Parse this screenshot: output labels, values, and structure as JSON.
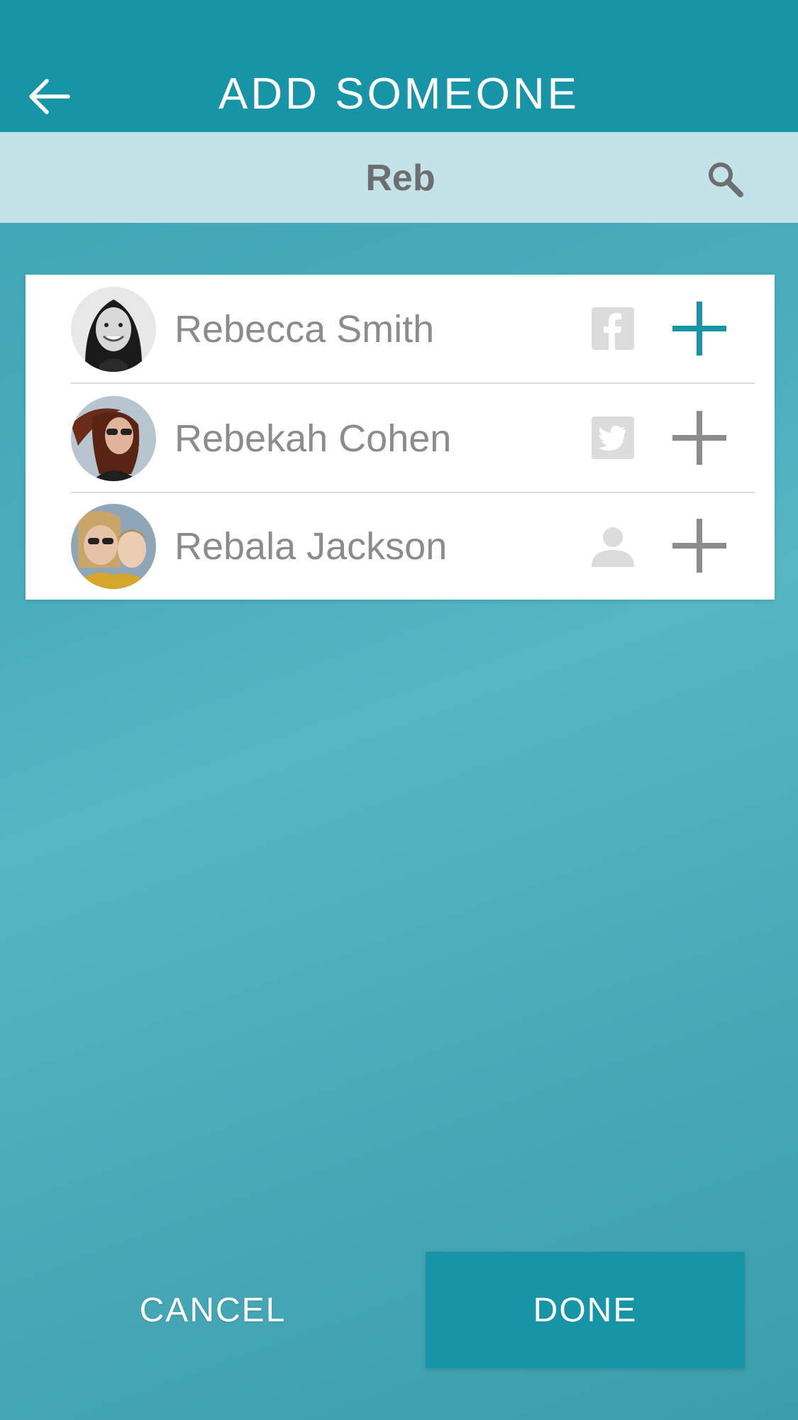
{
  "header": {
    "title": "ADD SOMEONE",
    "back_icon": "arrow-left-icon"
  },
  "search": {
    "value": "Reb",
    "icon": "search-icon"
  },
  "results": [
    {
      "name": "Rebecca Smith",
      "source": "facebook",
      "source_icon": "facebook-icon",
      "added": true
    },
    {
      "name": "Rebekah Cohen",
      "source": "twitter",
      "source_icon": "twitter-icon",
      "added": false
    },
    {
      "name": "Rebala Jackson",
      "source": "contact",
      "source_icon": "person-icon",
      "added": false
    }
  ],
  "footer": {
    "cancel_label": "CANCEL",
    "done_label": "DONE"
  },
  "colors": {
    "primary": "#1794a6",
    "search_bg": "#c4e3e8",
    "add_active": "#1794a6",
    "add_inactive": "#8c8c8c",
    "source_icon": "#dcdcdc"
  }
}
